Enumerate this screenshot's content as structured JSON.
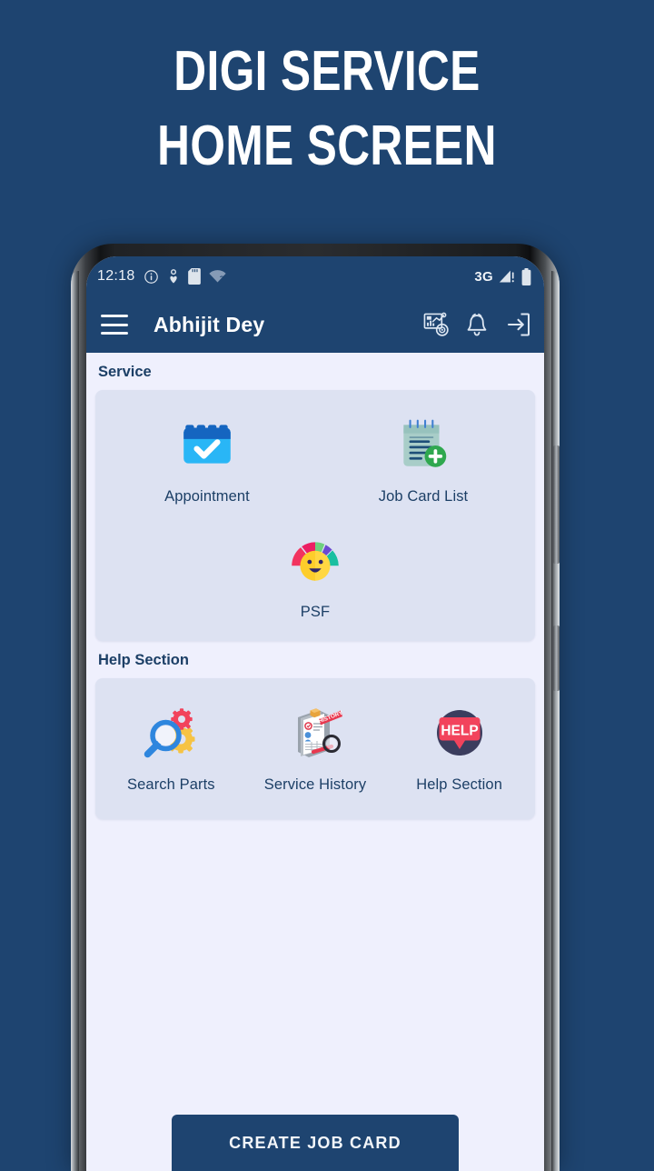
{
  "promo": {
    "line1": "DIGI SERVICE",
    "line2": "HOME SCREEN"
  },
  "colors": {
    "brand_navy": "#1e4470",
    "page_bg": "#eff0fd",
    "card_bg": "#dde2f2",
    "text_navy": "#1c3f66",
    "accent_green": "#2fa84f",
    "accent_red": "#f2435c"
  },
  "statusbar": {
    "time": "12:18",
    "network": "3G",
    "icons_left": [
      "info-icon",
      "health-icon",
      "sd-card-icon",
      "wifi-unknown-icon"
    ],
    "icons_right": [
      "signal-alert-icon",
      "battery-icon"
    ]
  },
  "appbar": {
    "menu_icon": "hamburger-menu-icon",
    "title": "Abhijit Dey",
    "actions": [
      {
        "icon": "analytics-dashboard-icon"
      },
      {
        "icon": "notification-bell-icon"
      },
      {
        "icon": "logout-icon"
      }
    ]
  },
  "sections": [
    {
      "title": "Service",
      "tiles": [
        {
          "label": "Appointment",
          "icon": "calendar-check-icon"
        },
        {
          "label": "Job Card List",
          "icon": "notepad-add-icon"
        },
        {
          "label": "PSF",
          "icon": "satisfaction-gauge-icon"
        }
      ]
    },
    {
      "title": "Help Section",
      "tiles": [
        {
          "label": "Search Parts",
          "icon": "magnifier-gears-icon"
        },
        {
          "label": "Service History",
          "icon": "clipboard-history-icon"
        },
        {
          "label": "Help Section",
          "icon": "help-bubble-icon"
        }
      ]
    }
  ],
  "cta": {
    "label": "CREATE JOB CARD"
  }
}
